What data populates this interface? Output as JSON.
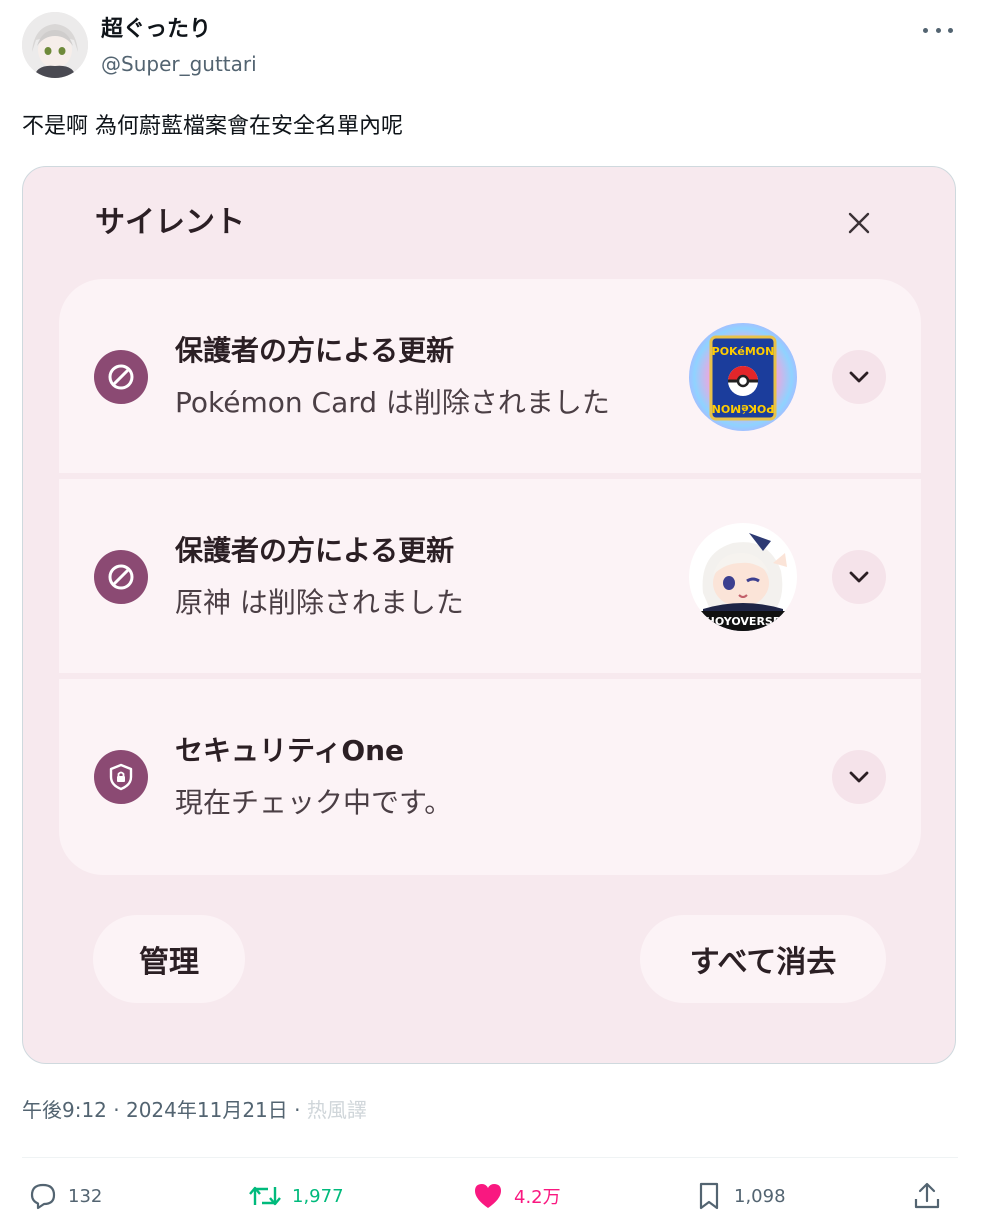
{
  "author": {
    "name": "超ぐったり",
    "handle": "@Super_guttari"
  },
  "tweet": {
    "text": "不是啊 為何蔚藍檔案會在安全名單內呢"
  },
  "screenshot": {
    "title": "サイレント",
    "items": [
      {
        "title": "保護者の方による更新",
        "subtitle": "Pokémon Card は削除されました",
        "icon": "block-icon",
        "thumb_label": "POKéMON"
      },
      {
        "title": "保護者の方による更新",
        "subtitle": "原神 は削除されました",
        "icon": "block-icon",
        "thumb_label": "HOYOVERSE"
      },
      {
        "title": "セキュリティOne",
        "subtitle": "現在チェック中です。",
        "icon": "shield-lock-icon"
      }
    ],
    "manage_label": "管理",
    "clear_all_label": "すべて消去"
  },
  "meta": {
    "timestamp": "午後9:12 · 2024年11月21日 · ",
    "views": "热風譯"
  },
  "actions": {
    "replies": "132",
    "reposts": "1,977",
    "likes": "4.2万",
    "bookmarks": "1,098"
  },
  "colors": {
    "accent": "#8b4a73",
    "panel_bg": "#f7e9ee",
    "repost": "#00ba7c",
    "like": "#f91880"
  }
}
